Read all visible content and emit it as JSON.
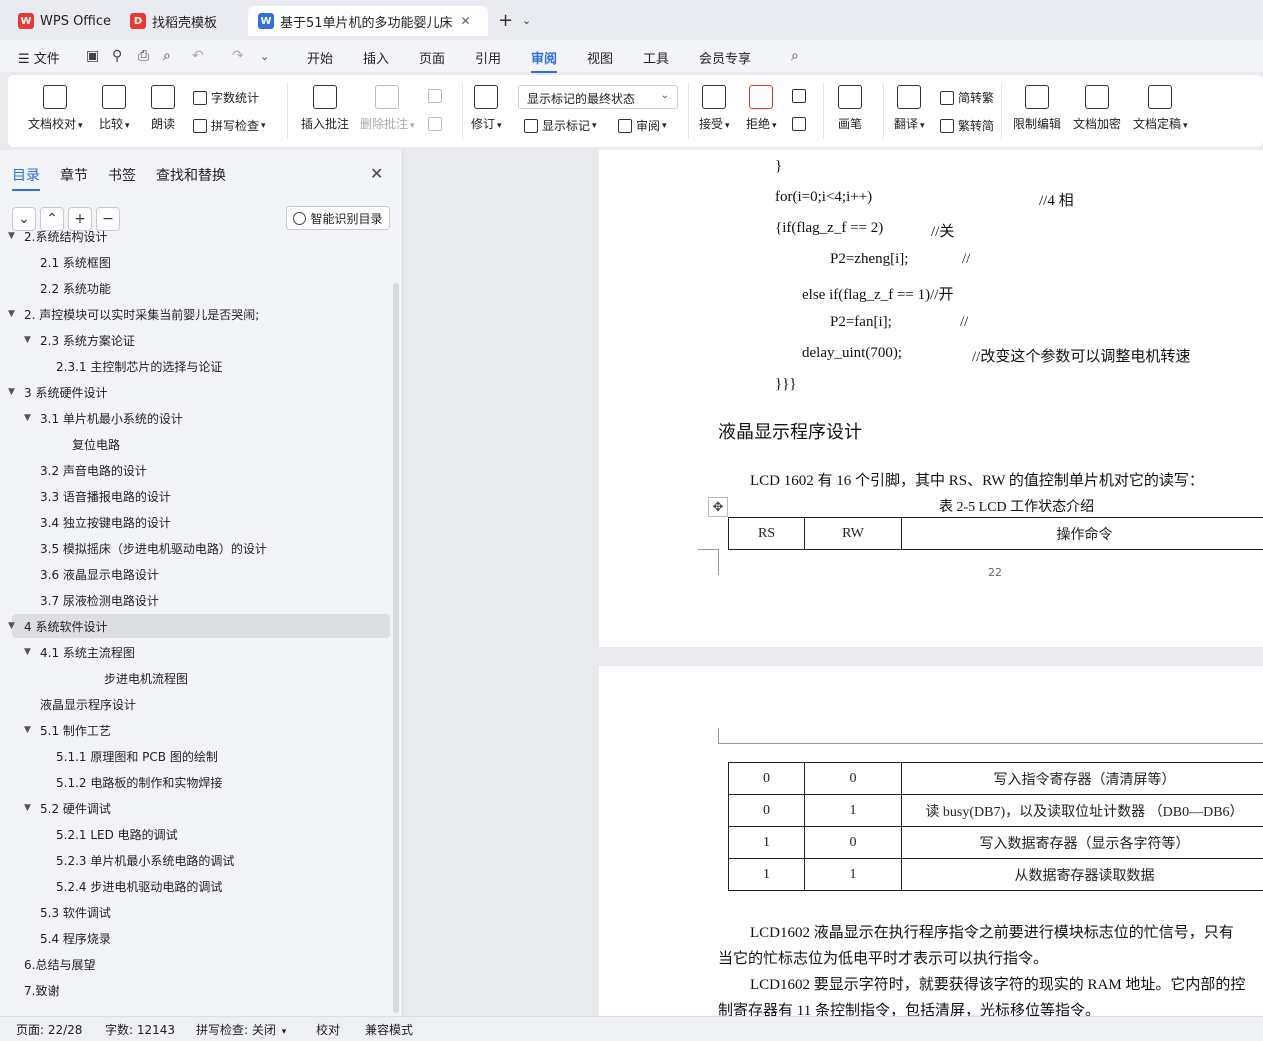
{
  "tabs": [
    {
      "label": "WPS Office",
      "icon": "wps-icon",
      "color": "#e53935"
    },
    {
      "label": "找稻壳模板",
      "icon": "daoke-icon",
      "color": "#e53935"
    },
    {
      "label": "基于51单片机的多功能婴儿床",
      "icon": "word-icon",
      "color": "#2f6fe0"
    }
  ],
  "menu": {
    "file": "文件",
    "items": [
      "开始",
      "插入",
      "页面",
      "引用",
      "审阅",
      "视图",
      "工具",
      "会员专享"
    ],
    "active": "审阅"
  },
  "ribbon": {
    "doc_check": "文档校对",
    "compare": "比较",
    "read": "朗读",
    "word_count": "字数统计",
    "spell_check": "拼写检查",
    "insert_comment": "插入批注",
    "delete_comment": "删除批注",
    "revise": "修订",
    "show_mode": "显示标记的最终状态",
    "show_marks": "显示标记",
    "review": "审阅",
    "accept": "接受",
    "reject": "拒绝",
    "pen": "画笔",
    "translate": "翻译",
    "to_trad": "简转繁",
    "to_simp": "繁转简",
    "restrict": "限制编辑",
    "encrypt": "文档加密",
    "finalize": "文档定稿"
  },
  "panel": {
    "tabs": [
      "目录",
      "章节",
      "书签",
      "查找和替换"
    ],
    "smart_toc": "智能识别目录",
    "toc": [
      {
        "text": "2.系统结构设计",
        "level": 0,
        "arrow": "▼"
      },
      {
        "text": "2.1  系统框图",
        "level": 1,
        "arrow": ""
      },
      {
        "text": "2.2  系统功能",
        "level": 1,
        "arrow": ""
      },
      {
        "text": "2. 声控模块可以实时采集当前婴儿是否哭闹;",
        "level": 0,
        "arrow": "▼"
      },
      {
        "text": "2.3  系统方案论证",
        "level": 1,
        "arrow": "▼"
      },
      {
        "text": "2.3.1  主控制芯片的选择与论证",
        "level": 2,
        "arrow": ""
      },
      {
        "text": "3 系统硬件设计",
        "level": 0,
        "arrow": "▼"
      },
      {
        "text": "3.1  单片机最小系统的设计",
        "level": 1,
        "arrow": "▼"
      },
      {
        "text": "复位电路",
        "level": 3,
        "arrow": ""
      },
      {
        "text": "3.2  声音电路的设计",
        "level": 1,
        "arrow": ""
      },
      {
        "text": "3.3 语音播报电路的设计",
        "level": 1,
        "arrow": ""
      },
      {
        "text": "3.4  独立按键电路的设计",
        "level": 1,
        "arrow": ""
      },
      {
        "text": "3.5  模拟摇床（步进电机驱动电路）的设计",
        "level": 1,
        "arrow": ""
      },
      {
        "text": "3.6  液晶显示电路设计",
        "level": 1,
        "arrow": ""
      },
      {
        "text": "3.7 尿液检测电路设计",
        "level": 1,
        "arrow": ""
      },
      {
        "text": "4 系统软件设计",
        "level": 0,
        "arrow": "▼",
        "selected": true
      },
      {
        "text": "4.1  系统主流程图",
        "level": 1,
        "arrow": "▼"
      },
      {
        "text": "步进电机流程图",
        "level": 4,
        "arrow": ""
      },
      {
        "text": "液晶显示程序设计",
        "level": 1,
        "arrow": ""
      },
      {
        "text": "5.1  制作工艺",
        "level": 1,
        "arrow": "▼"
      },
      {
        "text": "5.1.1 原理图和 PCB 图的绘制",
        "level": 2,
        "arrow": ""
      },
      {
        "text": "5.1.2  电路板的制作和实物焊接",
        "level": 2,
        "arrow": ""
      },
      {
        "text": "5.2  硬件调试",
        "level": 1,
        "arrow": "▼"
      },
      {
        "text": "5.2.1 LED 电路的调试",
        "level": 2,
        "arrow": ""
      },
      {
        "text": "5.2.3 单片机最小系统电路的调试",
        "level": 2,
        "arrow": ""
      },
      {
        "text": "5.2.4 步进电机驱动电路的调试",
        "level": 2,
        "arrow": ""
      },
      {
        "text": "5.3  软件调试",
        "level": 1,
        "arrow": ""
      },
      {
        "text": "5.4  程序烧录",
        "level": 1,
        "arrow": ""
      },
      {
        "text": "6.总结与展望",
        "level": 0,
        "arrow": ""
      },
      {
        "text": "7.致谢",
        "level": 0,
        "arrow": ""
      }
    ]
  },
  "doc": {
    "code_lines": [
      "}",
      "for(i=0;i<4;i++)",
      "//4 相",
      "{if(flag_z_f == 2)",
      "//关",
      "P2=zheng[i];",
      "//",
      "else if(flag_z_f == 1)//开",
      "P2=fan[i];",
      "//",
      "delay_uint(700);",
      "//改变这个参数可以调整电机转速",
      "}}}"
    ],
    "heading": "液晶显示程序设计",
    "intro": "LCD 1602 有 16 个引脚，其中 RS、RW 的值控制单片机对它的读写：",
    "table_caption": "表 2-5   LCD 工作状态介绍",
    "table_header": [
      "RS",
      "RW",
      "操作命令"
    ],
    "page_number": "22",
    "table_rows": [
      [
        "0",
        "0",
        "写入指令寄存器（清清屏等）"
      ],
      [
        "0",
        "1",
        "读 busy(DB7)，以及读取位址计数器 （DB0—DB6）"
      ],
      [
        "1",
        "0",
        "写入数据寄存器（显示各字符等）"
      ],
      [
        "1",
        "1",
        "从数据寄存器读取数据"
      ]
    ],
    "para1_a": "LCD1602 液晶显示在执行程序指令之前要进行模块标志位的忙信号，只有",
    "para1_b": "当它的忙标志位为低电平时才表示可以执行指令。",
    "para2_a": "LCD1602 要显示字符时，就要获得该字符的现实的 RAM 地址。它内部的控",
    "para2_b": "制寄存器有 11 条控制指令，包括清屏，光标移位等指令。"
  },
  "status": {
    "page": "页面: 22/28",
    "words": "字数: 12143",
    "spell": "拼写检查: 关闭",
    "proof": "校对",
    "compat": "兼容模式"
  }
}
